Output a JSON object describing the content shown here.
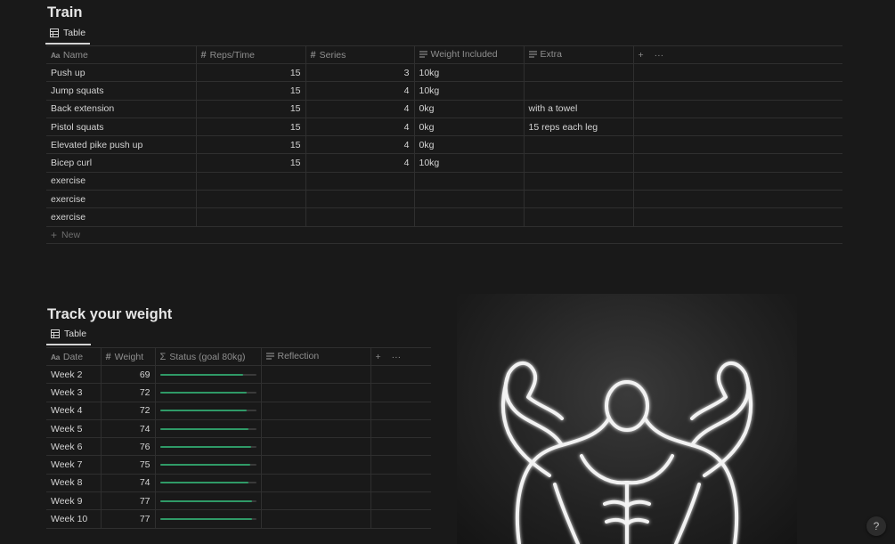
{
  "train": {
    "title": "Train",
    "view_tab": "Table",
    "columns": {
      "name": "Name",
      "reps": "Reps/Time",
      "series": "Series",
      "weight": "Weight Included",
      "extra": "Extra"
    },
    "rows": [
      {
        "name": "Push up",
        "reps": "15",
        "series": "3",
        "weight": "10kg",
        "extra": ""
      },
      {
        "name": "Jump squats",
        "reps": "15",
        "series": "4",
        "weight": "10kg",
        "extra": ""
      },
      {
        "name": "Back extension",
        "reps": "15",
        "series": "4",
        "weight": "0kg",
        "extra": "with a towel"
      },
      {
        "name": "Pistol squats",
        "reps": "15",
        "series": "4",
        "weight": "0kg",
        "extra": "15 reps each leg"
      },
      {
        "name": "Elevated pike push up",
        "reps": "15",
        "series": "4",
        "weight": "0kg",
        "extra": ""
      },
      {
        "name": "Bicep curl",
        "reps": "15",
        "series": "4",
        "weight": "10kg",
        "extra": ""
      },
      {
        "name": "exercise",
        "reps": "",
        "series": "",
        "weight": "",
        "extra": ""
      },
      {
        "name": "exercise",
        "reps": "",
        "series": "",
        "weight": "",
        "extra": ""
      },
      {
        "name": "exercise",
        "reps": "",
        "series": "",
        "weight": "",
        "extra": ""
      }
    ],
    "new_label": "New"
  },
  "weight": {
    "title": "Track your weight",
    "view_tab": "Table",
    "columns": {
      "date": "Date",
      "weight": "Weight",
      "status": "Status (goal 80kg)",
      "reflection": "Reflection"
    },
    "goal": 80,
    "rows": [
      {
        "date": "Week 2",
        "weight": "69",
        "progress": 0.8625
      },
      {
        "date": "Week 3",
        "weight": "72",
        "progress": 0.9
      },
      {
        "date": "Week 4",
        "weight": "72",
        "progress": 0.9
      },
      {
        "date": "Week 5",
        "weight": "74",
        "progress": 0.925
      },
      {
        "date": "Week 6",
        "weight": "76",
        "progress": 0.95
      },
      {
        "date": "Week 7",
        "weight": "75",
        "progress": 0.9375
      },
      {
        "date": "Week 8",
        "weight": "74",
        "progress": 0.925
      },
      {
        "date": "Week 9",
        "weight": "77",
        "progress": 0.9625
      },
      {
        "date": "Week 10",
        "weight": "77",
        "progress": 0.9625
      }
    ]
  },
  "colors": {
    "background": "#191919",
    "progress_fill": "#2f9a67",
    "progress_track": "#3a3a3a"
  },
  "help_label": "?"
}
